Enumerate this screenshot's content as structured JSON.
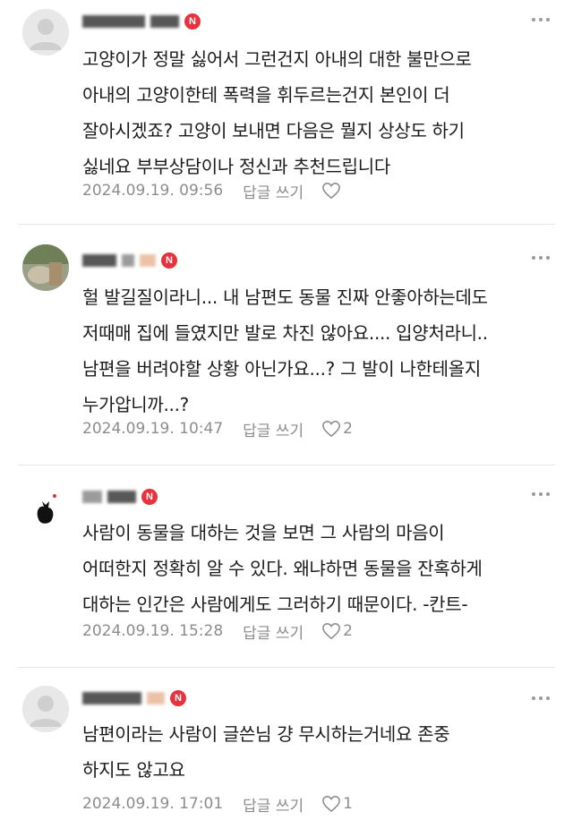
{
  "comments": [
    {
      "text": "고양이가 정말 싫어서 그런건지 아내의 대한 불만으로\n아내의 고양이한테 폭력을 휘두르는건지 본인이 더\n잘아시겠죠? 고양이 보내면 다음은 뭘지 상상도 하기\n싫네요 부부상담이나 정신과 추천드립니다",
      "date": "2024.09.19. 09:56",
      "reply_label": "답글 쓰기",
      "like_count": ""
    },
    {
      "text": "헐 발길질이라니... 내 남편도 동물 진짜 안좋아하는데도\n저때매 집에 들였지만 발로 차진 않아요.... 입양처라니..\n남편을 버려야할 상황 아닌가요...? 그 발이 나한테올지\n누가압니까...?",
      "date": "2024.09.19. 10:47",
      "reply_label": "답글 쓰기",
      "like_count": "2"
    },
    {
      "text": "사람이 동물을 대하는 것을 보면 그 사람의 마음이\n어떠한지 정확히 알 수 있다. 왜냐하면 동물을 잔혹하게\n대하는 인간은 사람에게도 그러하기 때문이다. -칸트-",
      "date": "2024.09.19. 15:28",
      "reply_label": "답글 쓰기",
      "like_count": "2"
    },
    {
      "text": "남편이라는 사람이 글쓴님 걍 무시하는거네요 존중\n하지도 않고요",
      "date": "2024.09.19. 17:01",
      "reply_label": "답글 쓰기",
      "like_count": "1"
    }
  ],
  "badge_letter": "N",
  "colors": {
    "badge": "#e7333d",
    "meta": "#8c8c8c",
    "divider": "#e6e6e6"
  },
  "icons": {
    "more": "more-vertical-dots-icon",
    "like": "heart-outline-icon",
    "avatar": "default-avatar-icon"
  }
}
